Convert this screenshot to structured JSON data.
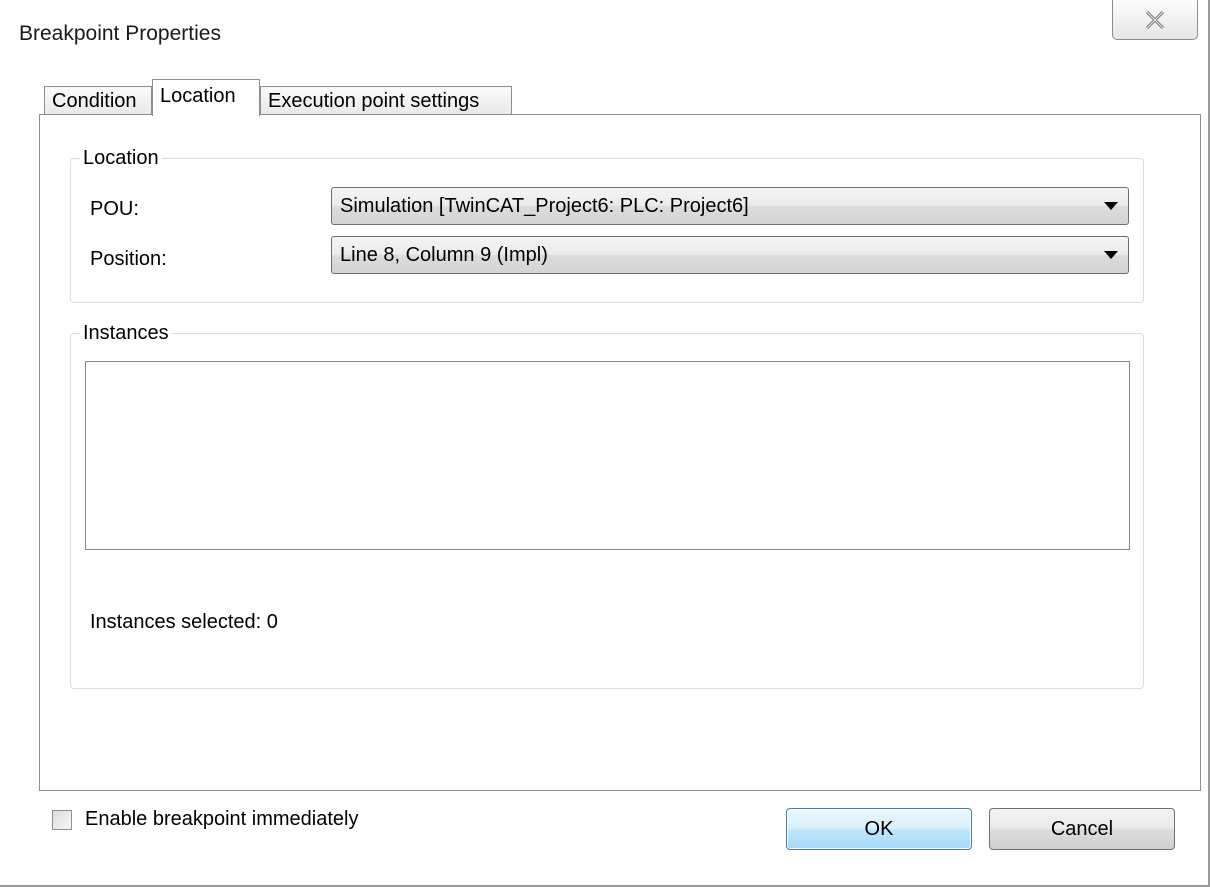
{
  "window": {
    "title": "Breakpoint Properties",
    "close_icon": "close-icon"
  },
  "tabs": [
    {
      "label": "Condition",
      "active": false
    },
    {
      "label": "Location",
      "active": true
    },
    {
      "label": "Execution point settings",
      "active": false
    }
  ],
  "location_group": {
    "legend": "Location",
    "pou_label": "POU:",
    "pou_value": "Simulation [TwinCAT_Project6: PLC: Project6]",
    "position_label": "Position:",
    "position_value": "Line 8, Column 9 (Impl)"
  },
  "instances_group": {
    "legend": "Instances",
    "items": [],
    "selected_text": "Instances selected: 0"
  },
  "footer": {
    "enable_label": "Enable breakpoint immediately",
    "enable_checked": false,
    "ok_label": "OK",
    "cancel_label": "Cancel"
  }
}
